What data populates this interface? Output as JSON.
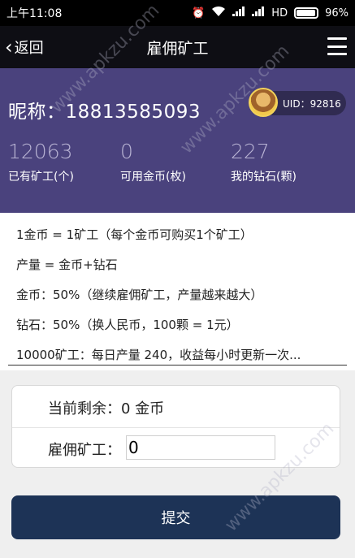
{
  "status_bar": {
    "time": "上午11:08",
    "network": "HD",
    "battery_percent": "96%",
    "battery_level": 0.96
  },
  "nav": {
    "back_label": "返回",
    "title": "雇佣矿工"
  },
  "profile": {
    "nickname": "昵称：18813585093",
    "uid": "UID：92816",
    "stats": [
      {
        "value": "12063",
        "label": "已有矿工(个)"
      },
      {
        "value": "0",
        "label": "可用金币(枚)"
      },
      {
        "value": "227",
        "label": "我的钻石(颗)"
      }
    ]
  },
  "info_lines": [
    "1金币 = 1矿工（每个金币可购买1个矿工）",
    "产量 = 金币+钻石",
    "金币：50%（继续雇佣矿工，产量越来越大）",
    "钻石：50%（换人民币，100颗 = 1元）",
    "10000矿工：每日产量 240，收益每小时更新一次..."
  ],
  "form": {
    "balance": "当前剩余：0 金币",
    "hire_label": "雇佣矿工：",
    "hire_value": "0"
  },
  "submit_label": "提交",
  "watermark": "www.apkzu.com",
  "colors": {
    "profile_bg": "#4a427d",
    "submit_bg": "#1d3356",
    "nav_bg": "#0e0e14"
  }
}
